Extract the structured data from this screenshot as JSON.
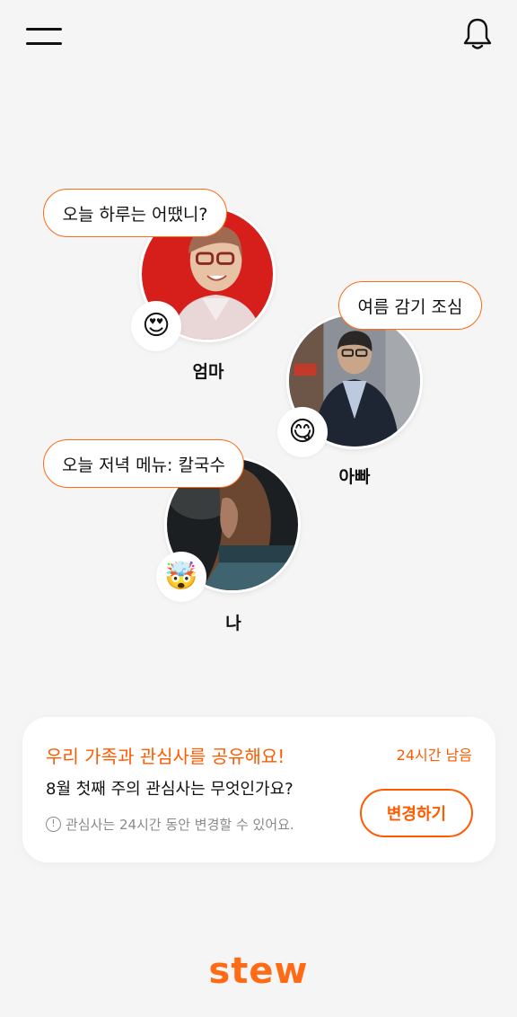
{
  "header": {
    "menu_icon": "hamburger-menu-icon",
    "notification_icon": "bell-icon"
  },
  "members": [
    {
      "name": "엄마",
      "status_message": "오늘 하루는 어땠니?",
      "emoji": "😍",
      "emoji_name": "heart-eyes-emoji"
    },
    {
      "name": "아빠",
      "status_message": "여름 감기 조심",
      "emoji": "😋",
      "emoji_name": "savoring-food-emoji"
    },
    {
      "name": "나",
      "status_message": "오늘 저녁 메뉴: 칼국수",
      "emoji": "🤯",
      "emoji_name": "exploding-head-emoji"
    }
  ],
  "interest_card": {
    "title": "우리 가족과 관심사를 공유해요!",
    "remaining": "24시간 남음",
    "question": "8월 첫째 주의 관심사는 무엇인가요?",
    "note_icon": "!",
    "note": "관심사는 24시간 동안 변경할 수 있어요.",
    "change_button": "변경하기"
  },
  "brand": {
    "logo": "stew",
    "accent_color": "#ff6a14"
  }
}
